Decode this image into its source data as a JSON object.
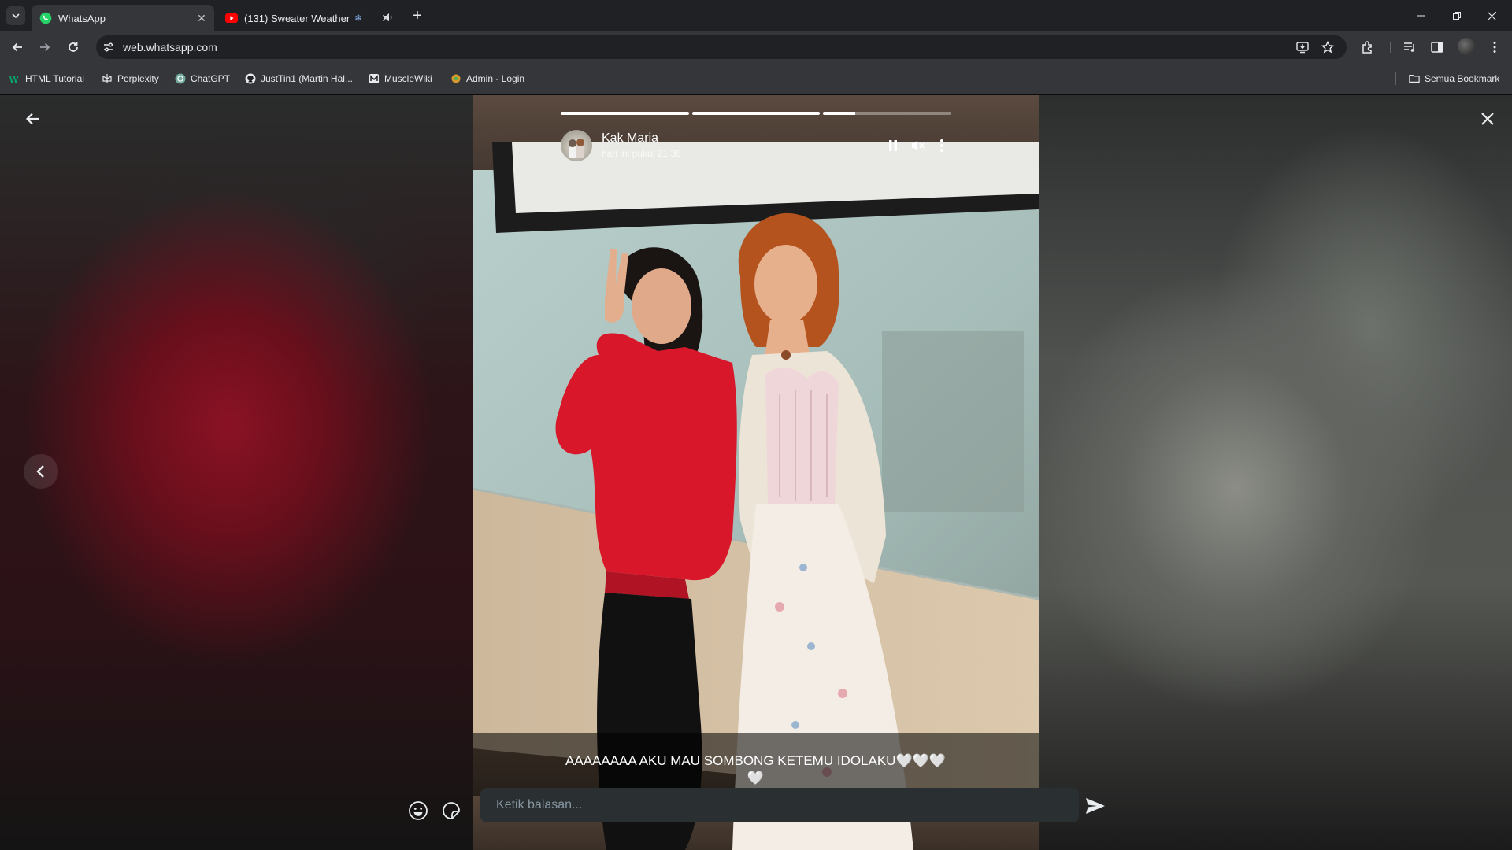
{
  "browser": {
    "tabs": [
      {
        "title": "WhatsApp",
        "favicon": "whatsapp-icon",
        "active": true
      },
      {
        "title": "(131) Sweater Weather",
        "favicon": "youtube-icon",
        "active": false,
        "extra": "❄"
      }
    ],
    "url": "web.whatsapp.com",
    "bookmarks": [
      {
        "label": "HTML Tutorial",
        "icon": "w3schools-icon"
      },
      {
        "label": "Perplexity",
        "icon": "perplexity-icon"
      },
      {
        "label": "ChatGPT",
        "icon": "chatgpt-icon"
      },
      {
        "label": "JustTin1 (Martin Hal...",
        "icon": "github-icon"
      },
      {
        "label": "MuscleWiki",
        "icon": "musclewiki-icon"
      },
      {
        "label": "Admin - Login",
        "icon": "admin-icon"
      }
    ],
    "all_bookmarks_label": "Semua Bookmark"
  },
  "status": {
    "contact_name": "Kak Maria",
    "timestamp": "hari ini pukul 21.38",
    "progress_segments": [
      1.0,
      1.0,
      0.25
    ],
    "caption_line1": "AAAAAAAA AKU MAU SOMBONG KETEMU IDOLAKU🤍🤍🤍",
    "caption_line2": "🤍",
    "reply_placeholder": "Ketik balasan..."
  },
  "colors": {
    "chrome_dark": "#202124",
    "chrome_toolbar": "#35363a",
    "whatsapp_green": "#25d366",
    "youtube_red": "#ff0000",
    "input_bg": "#2a2f32"
  }
}
